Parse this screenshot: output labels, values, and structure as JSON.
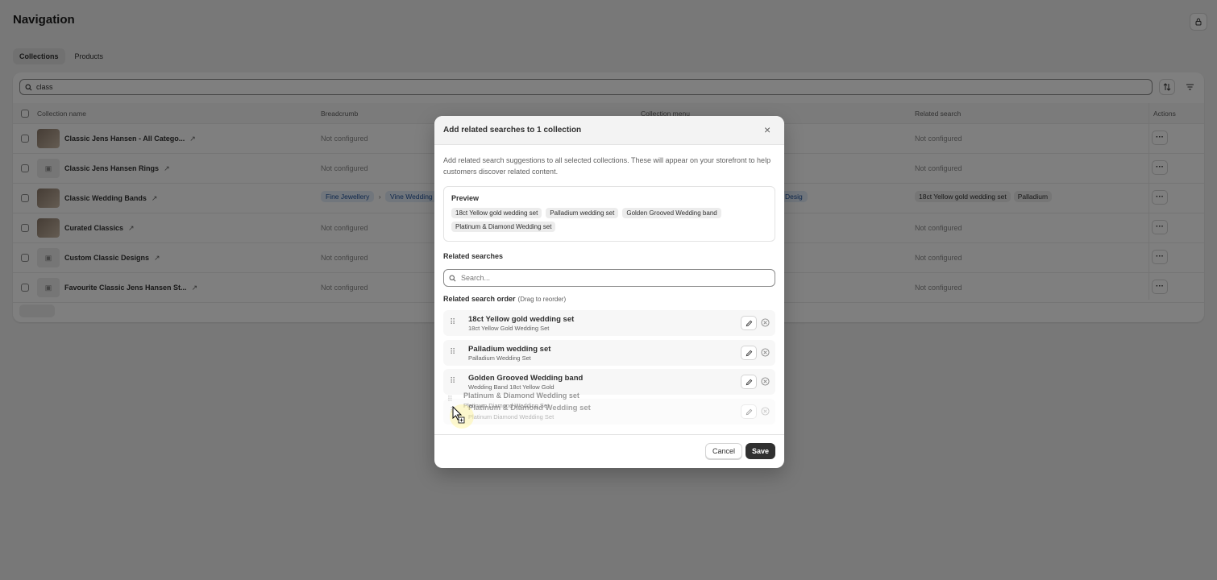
{
  "page": {
    "title": "Navigation",
    "tabs": [
      {
        "label": "Collections"
      },
      {
        "label": "Products"
      }
    ],
    "search_value": "class",
    "columns": [
      "Collection name",
      "Breadcrumb",
      "Collection menu",
      "Related search",
      "Actions"
    ],
    "rows": [
      {
        "name": "Classic Jens Hansen - All Catego...",
        "breadcrumb": "Not configured",
        "related": "Not configured",
        "thumb": "photo"
      },
      {
        "name": "Classic Jens Hansen Rings",
        "breadcrumb": "Not configured",
        "related": "Not configured",
        "thumb": "placeholder"
      },
      {
        "name": "Classic Wedding Bands",
        "breadcrumb_path": [
          "Fine Jewellery",
          "Vine Wedding"
        ],
        "menu_fragment": "Desig",
        "related_tags": [
          "18ct Yellow gold wedding set",
          "Palladium"
        ],
        "thumb": "photo"
      },
      {
        "name": "Curated Classics",
        "breadcrumb": "Not configured",
        "related": "Not configured",
        "thumb": "photo"
      },
      {
        "name": "Custom Classic Designs",
        "breadcrumb": "Not configured",
        "related": "Not configured",
        "thumb": "placeholder"
      },
      {
        "name": "Favourite Classic Jens Hansen St...",
        "breadcrumb": "Not configured",
        "related": "Not configured",
        "thumb": "placeholder"
      }
    ],
    "actions_label": "···"
  },
  "modal": {
    "title": "Add related searches to 1 collection",
    "description": "Add related search suggestions to all selected collections. These will appear on your storefront to help customers discover related content.",
    "preview_title": "Preview",
    "preview_chips": [
      "18ct Yellow gold wedding set",
      "Palladium wedding set",
      "Golden Grooved Wedding band",
      "Platinum & Diamond Wedding set"
    ],
    "related_label": "Related searches",
    "search_placeholder": "Search...",
    "order_label": "Related search order",
    "order_hint": "(Drag to reorder)",
    "items": [
      {
        "title": "18ct Yellow gold wedding set",
        "subtitle": "18ct Yellow Gold Wedding Set"
      },
      {
        "title": "Palladium wedding set",
        "subtitle": "Palladium Wedding Set"
      },
      {
        "title": "Golden Grooved Wedding band",
        "subtitle": "Wedding Band 18ct Yellow Gold"
      },
      {
        "title": "Platinum & Diamond Wedding set",
        "subtitle": "Platinum Diamond Wedding Set"
      }
    ],
    "dragging": {
      "title": "Platinum & Diamond Wedding set",
      "subtitle": "Platinum Diamond Wedding Set"
    },
    "cancel_label": "Cancel",
    "save_label": "Save"
  },
  "colors": {
    "overlay": "#00000080",
    "primary_button": "#303030",
    "pill": "#e3ecf9"
  }
}
